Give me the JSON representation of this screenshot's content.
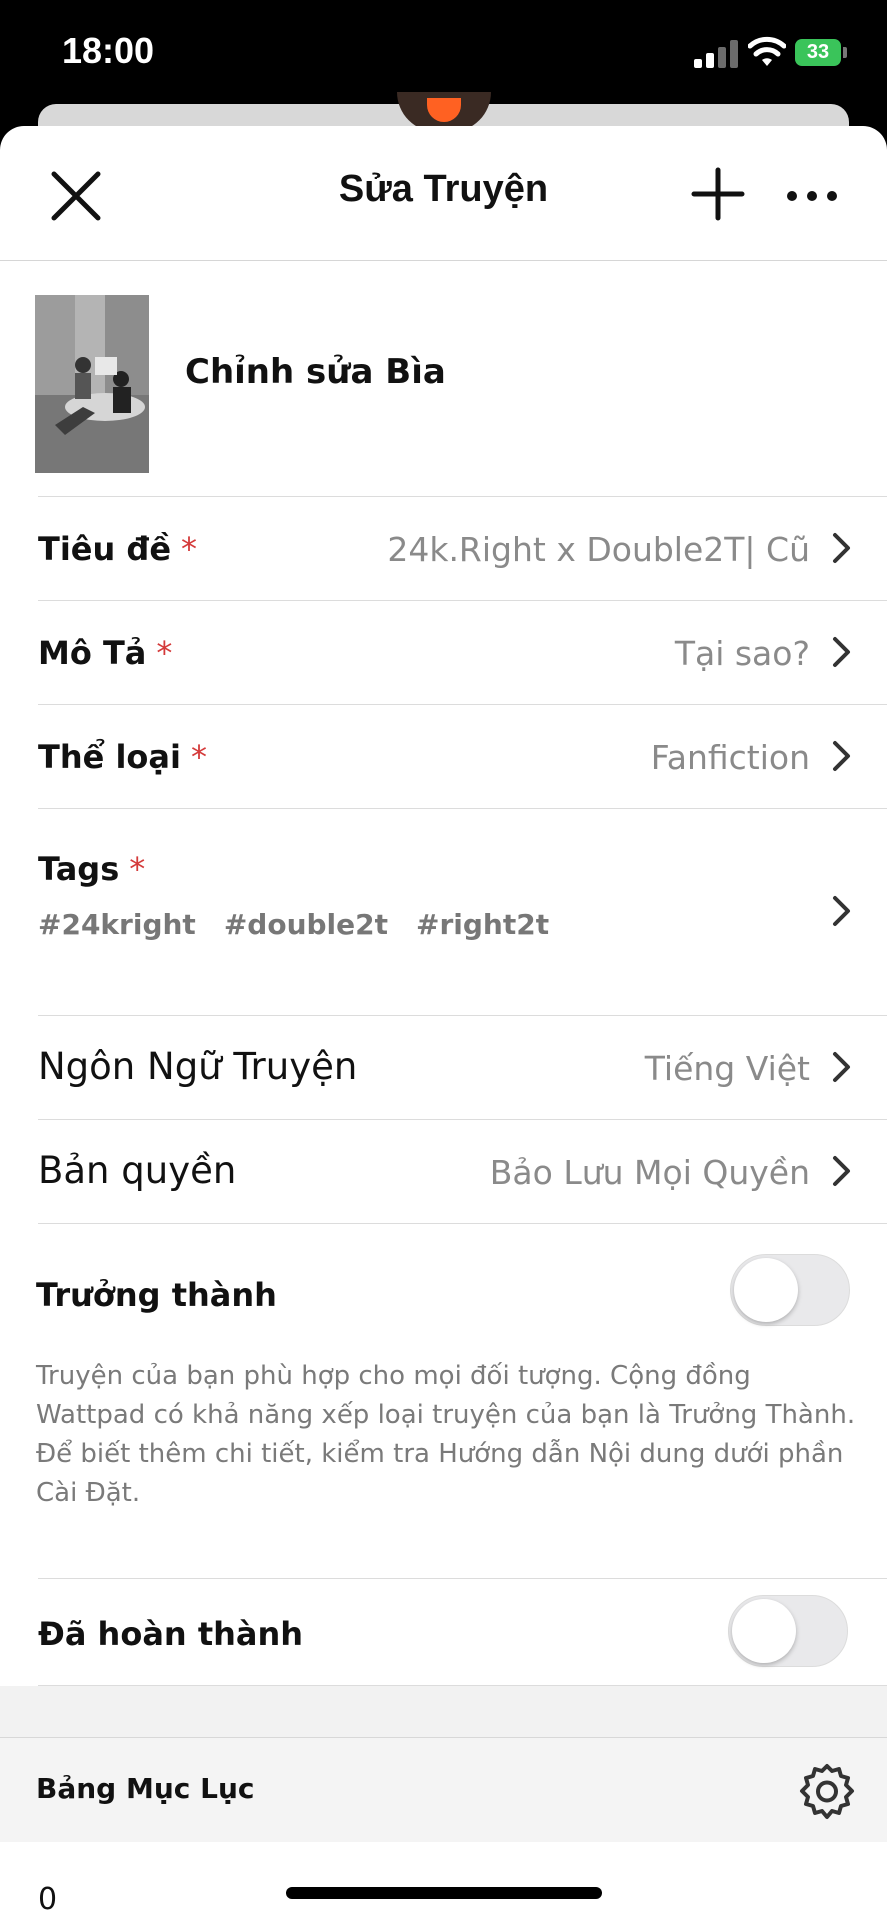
{
  "status_bar": {
    "time": "18:00",
    "battery": "33"
  },
  "nav": {
    "title": "Sửa Truyện"
  },
  "cover": {
    "label": "Chỉnh sửa Bìa"
  },
  "fields": {
    "title": {
      "label": "Tiêu đề",
      "required_mark": "*",
      "value": "24k.Right x Double2T| Cũ"
    },
    "description": {
      "label": "Mô Tả",
      "required_mark": "*",
      "value": "Tại sao?"
    },
    "category": {
      "label": "Thể loại",
      "required_mark": "*",
      "value": "Fanfiction"
    },
    "tags": {
      "label": "Tags",
      "required_mark": "*",
      "items": [
        "#24kright",
        "#double2t",
        "#right2t"
      ]
    },
    "language": {
      "label": "Ngôn Ngữ Truyện",
      "value": "Tiếng Việt"
    },
    "copyright": {
      "label": "Bản quyền",
      "value": "Bảo Lưu Mọi Quyền"
    }
  },
  "mature": {
    "label": "Trưởng thành",
    "enabled": false,
    "description": "Truyện của bạn phù hợp cho mọi đối tượng. Cộng đồng Wattpad có khả năng xếp loại truyện của bạn là Trưởng Thành. Để biết thêm chi tiết, kiểm tra Hướng dẫn Nội dung dưới phần Cài Đặt."
  },
  "completed": {
    "label": "Đã hoàn thành",
    "enabled": false
  },
  "toc": {
    "label": "Bảng Mục Lục",
    "first_item": "0"
  },
  "colors": {
    "required": "#d43a3a",
    "value_text": "#8a8a8a",
    "battery": "#3ac45a",
    "brand": "#ff6122"
  },
  "icons": [
    "close-icon",
    "plus-icon",
    "more-icon",
    "chevron-right-icon",
    "gear-icon",
    "wifi-icon",
    "signal-icon",
    "battery-icon"
  ]
}
